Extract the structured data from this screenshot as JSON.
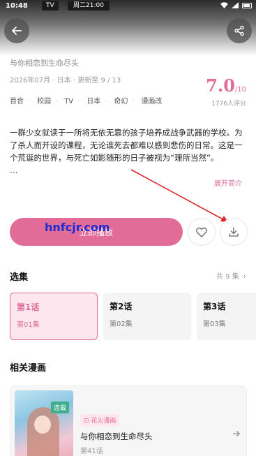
{
  "status_bar": {
    "time": "10:48",
    "tv_label": "TV",
    "date_label": "周二21:00"
  },
  "header": {
    "subtitle": "与你相恋到生命尽头"
  },
  "meta": {
    "year_month": "2026年07月",
    "region": "日本",
    "update": "更新至 9 / 13",
    "tags": [
      "百合",
      "校园",
      "TV",
      "日本",
      "奇幻",
      "漫画改"
    ]
  },
  "score": {
    "value": "7.0",
    "unit": "/10",
    "count": "1776人评分"
  },
  "description": {
    "text": "一群少女就读于一所将无依无靠的孩子培养成战争武器的学校。为了杀人而开设的课程，无论谁死去都难以感到悲伤的日常。这是一个荒诞的世界，与死亡如影随形的日子被视为“理所当然”。",
    "ellipsis": "…",
    "expand_label": "展开简介"
  },
  "actions": {
    "play_label": "立即播放",
    "watermark": "hnfcjr.com"
  },
  "episodes": {
    "section_title": "选集",
    "count_label": "共 9 集",
    "items": [
      {
        "title": "第1话",
        "sub": "第01集"
      },
      {
        "title": "第2话",
        "sub": "第02集"
      },
      {
        "title": "第3话",
        "sub": "第03集"
      }
    ]
  },
  "related": {
    "section_title": "相关漫画",
    "item": {
      "badge": "连载",
      "tag": "花火漫画",
      "title": "与你相恋到生命尽头",
      "sub": "第41话"
    }
  },
  "colors": {
    "accent": "#e26c98"
  }
}
